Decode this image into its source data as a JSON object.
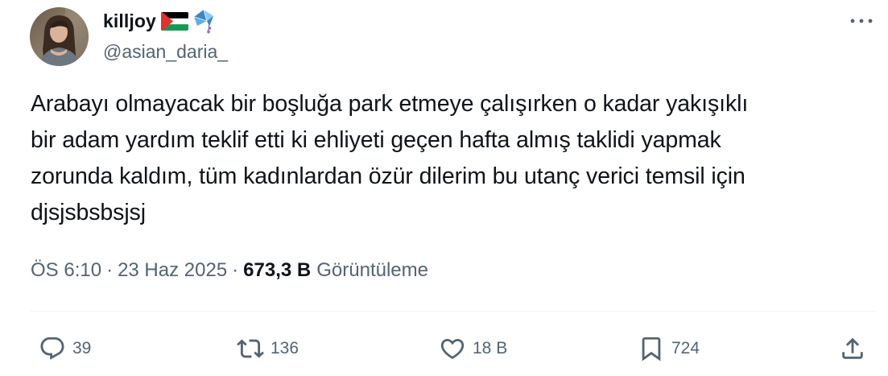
{
  "author": {
    "display_name": "killjoy",
    "handle": "@asian_daria_",
    "badges": [
      "palestine-flag-icon",
      "kite-icon"
    ]
  },
  "tweet": {
    "text": "Arabayı olmayacak bir boşluğa park etmeye çalışırken o kadar yakışıklı\nbir adam yardım teklif etti ki ehliyeti geçen hafta almış taklidi yapmak\nzorunda kaldım, tüm kadınlardan özür dilerim bu utanç verici temsil için\ndjsjsbsbsjsj"
  },
  "meta": {
    "time": "ÖS 6:10",
    "separator": "·",
    "date": "23 Haz 2025",
    "views_count": "673,3 B",
    "views_label": "Görüntüleme"
  },
  "actions": {
    "reply_count": "39",
    "retweet_count": "136",
    "like_count": "18 B",
    "bookmark_count": "724"
  },
  "colors": {
    "text_primary": "#0f1419",
    "text_secondary": "#536471",
    "divider": "#eff3f4"
  }
}
